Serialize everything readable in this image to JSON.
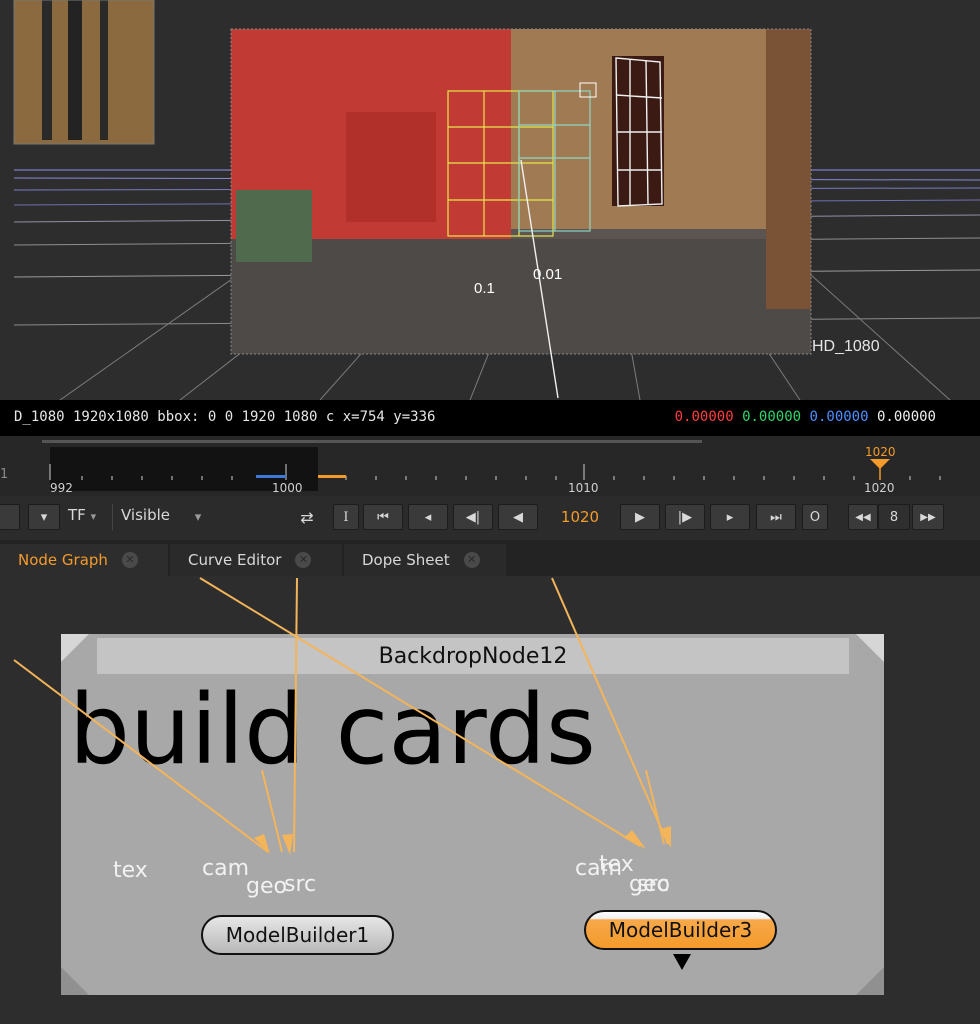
{
  "viewer": {
    "format_label": "HD_1080",
    "distance_labels": [
      "0.01",
      "0.1"
    ],
    "info_left": "D_1080 1920x1080  bbox: 0 0 1920 1080 c  x=754 y=336",
    "rgba": {
      "r": "0.00000",
      "g": "0.00000",
      "b": "0.00000",
      "a": "0.00000"
    },
    "colors": {
      "r": "#ff3d3d",
      "g": "#2fd46a",
      "b": "#4f8fff"
    }
  },
  "timeline": {
    "left_edge_label": "1",
    "tick_labels": [
      "992",
      "1000",
      "1010",
      "1020"
    ],
    "current_frame_marker": "1020",
    "accent_color": "#f39a2b"
  },
  "controls": {
    "tf_label": "TF",
    "visible_label": "Visible",
    "in_point_label": "I",
    "out_point_label": "O",
    "current_frame": "1020",
    "step_value": "8",
    "icons": [
      "dropdown-arrow-icon",
      "sync-icon",
      "skip-to-start-icon",
      "prev-keyframe-icon",
      "prev-frame-icon",
      "play-backward-icon",
      "play-forward-icon",
      "next-frame-icon",
      "next-keyframe-icon",
      "skip-to-end-icon",
      "step-back-icon",
      "step-forward-icon"
    ]
  },
  "tabs": [
    {
      "label": "Node Graph",
      "active": true
    },
    {
      "label": "Curve Editor",
      "active": false
    },
    {
      "label": "Dope Sheet",
      "active": false
    }
  ],
  "graph": {
    "backdrop_title": "BackdropNode12",
    "backdrop_label": "build cards",
    "nodes": [
      {
        "label": "ModelBuilder1",
        "selected": false
      },
      {
        "label": "ModelBuilder3",
        "selected": true
      }
    ],
    "inputs_node1": [
      "tex",
      "cam",
      "geo",
      "src"
    ],
    "inputs_node3": [
      "cam",
      "tex",
      "geo",
      "src"
    ],
    "wire_color": "#f3b45a",
    "selected_color": "#f7a94a"
  }
}
